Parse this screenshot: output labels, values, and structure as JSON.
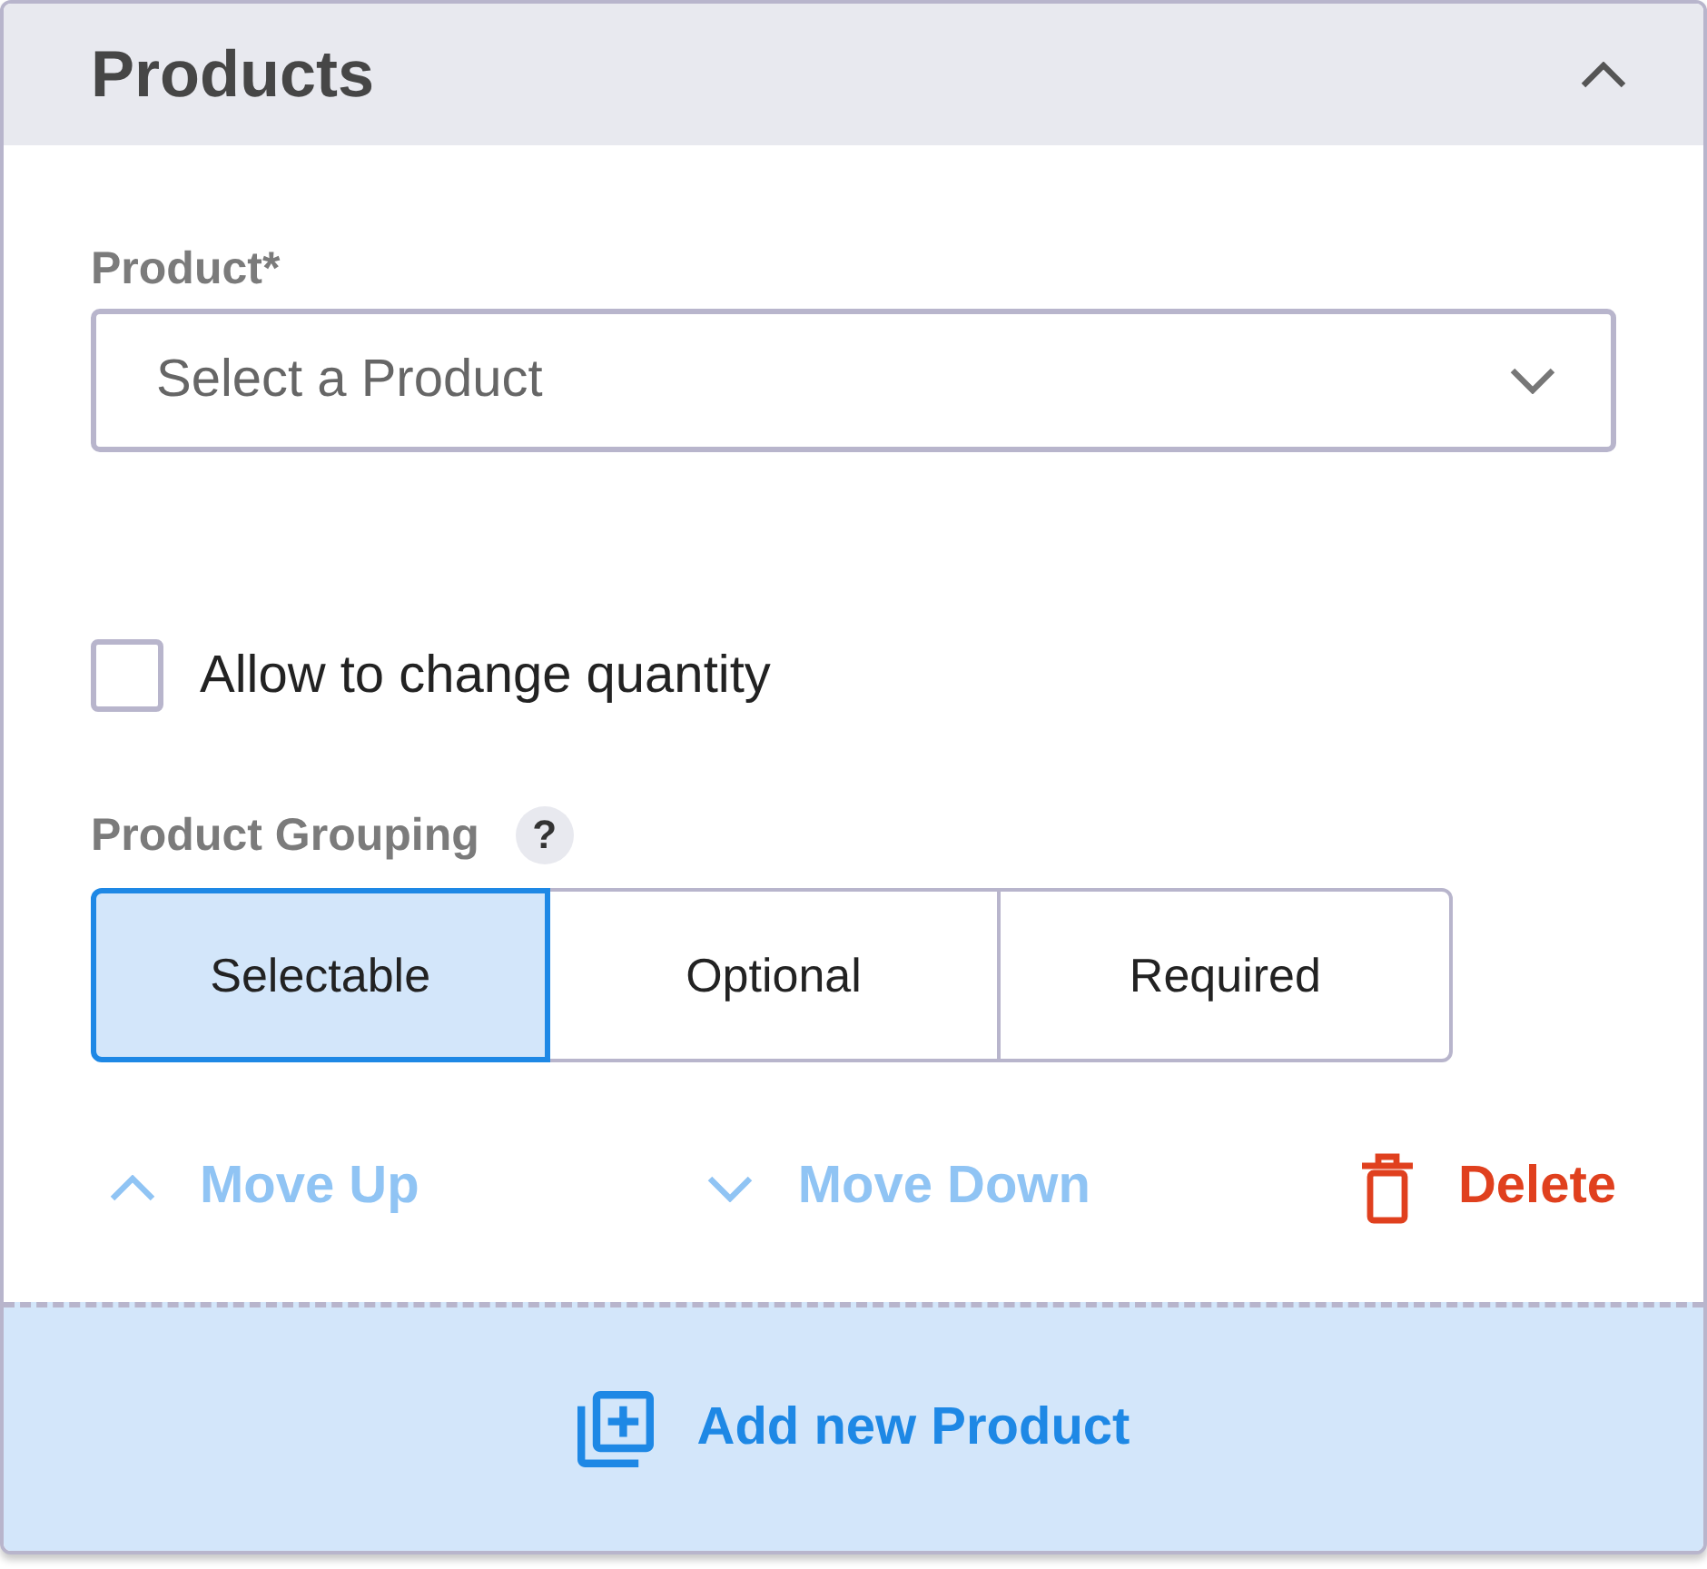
{
  "panel": {
    "title": "Products",
    "expanded": true
  },
  "product_field": {
    "label": "Product*",
    "placeholder": "Select a Product"
  },
  "allow_change_quantity": {
    "label": "Allow to change quantity",
    "checked": false
  },
  "product_grouping": {
    "label": "Product Grouping",
    "help": "?",
    "options": [
      {
        "label": "Selectable",
        "selected": true
      },
      {
        "label": "Optional",
        "selected": false
      },
      {
        "label": "Required",
        "selected": false
      }
    ]
  },
  "actions": [
    {
      "kind": "move_up",
      "label": "Move Up",
      "disabled": true
    },
    {
      "kind": "move_down",
      "label": "Move Down",
      "disabled": true
    },
    {
      "kind": "delete",
      "label": "Delete",
      "disabled": false
    }
  ],
  "add_button": {
    "label": "Add new Product"
  }
}
